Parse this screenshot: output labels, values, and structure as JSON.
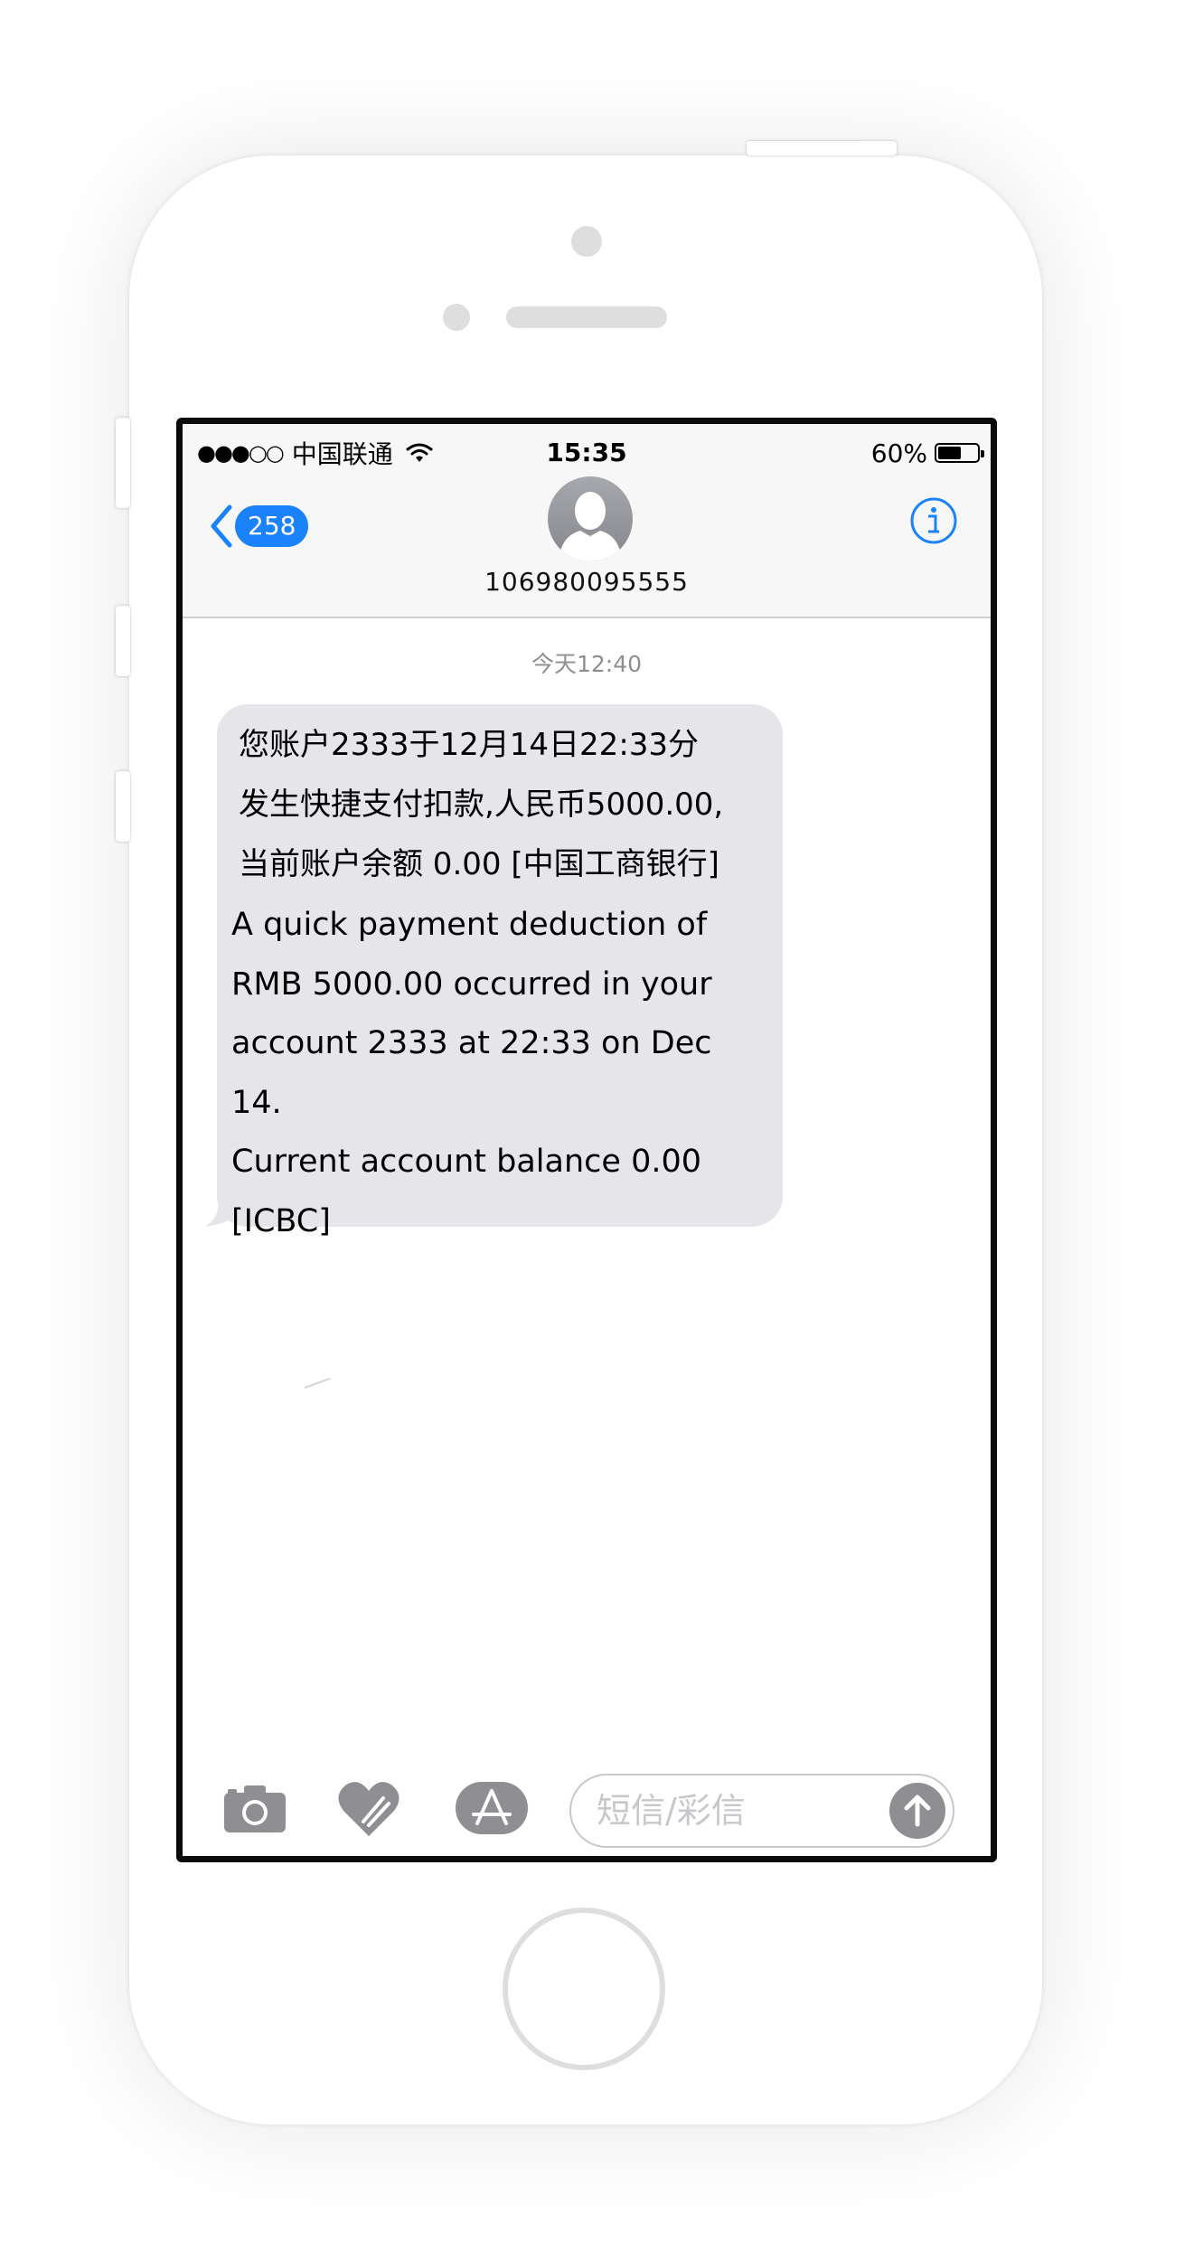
{
  "status_bar": {
    "signal": "●●●○○",
    "carrier": "中国联通",
    "time": "15:35",
    "battery_percent": "60%",
    "battery_level": 0.6
  },
  "nav": {
    "back_badge": "258",
    "contact_number": "106980095555",
    "accent_color": "#1a82fb"
  },
  "conversation": {
    "timestamp": "今天12:40",
    "message": {
      "chinese": "您账户2333于12月14日22:33分\n发生快捷支付扣款,人民币5000.00,\n当前账户余额 0.00 [中国工商银行]",
      "english": " A quick payment deduction of\nRMB 5000.00 occurred in your\naccount 2333 at 22:33 on Dec 14.\nCurrent account balance 0.00\n[ICBC]"
    }
  },
  "composer": {
    "placeholder": "短信/彩信",
    "icons": [
      "camera-icon",
      "digital-touch-heart-icon",
      "app-store-icon",
      "send-arrow-icon"
    ]
  }
}
